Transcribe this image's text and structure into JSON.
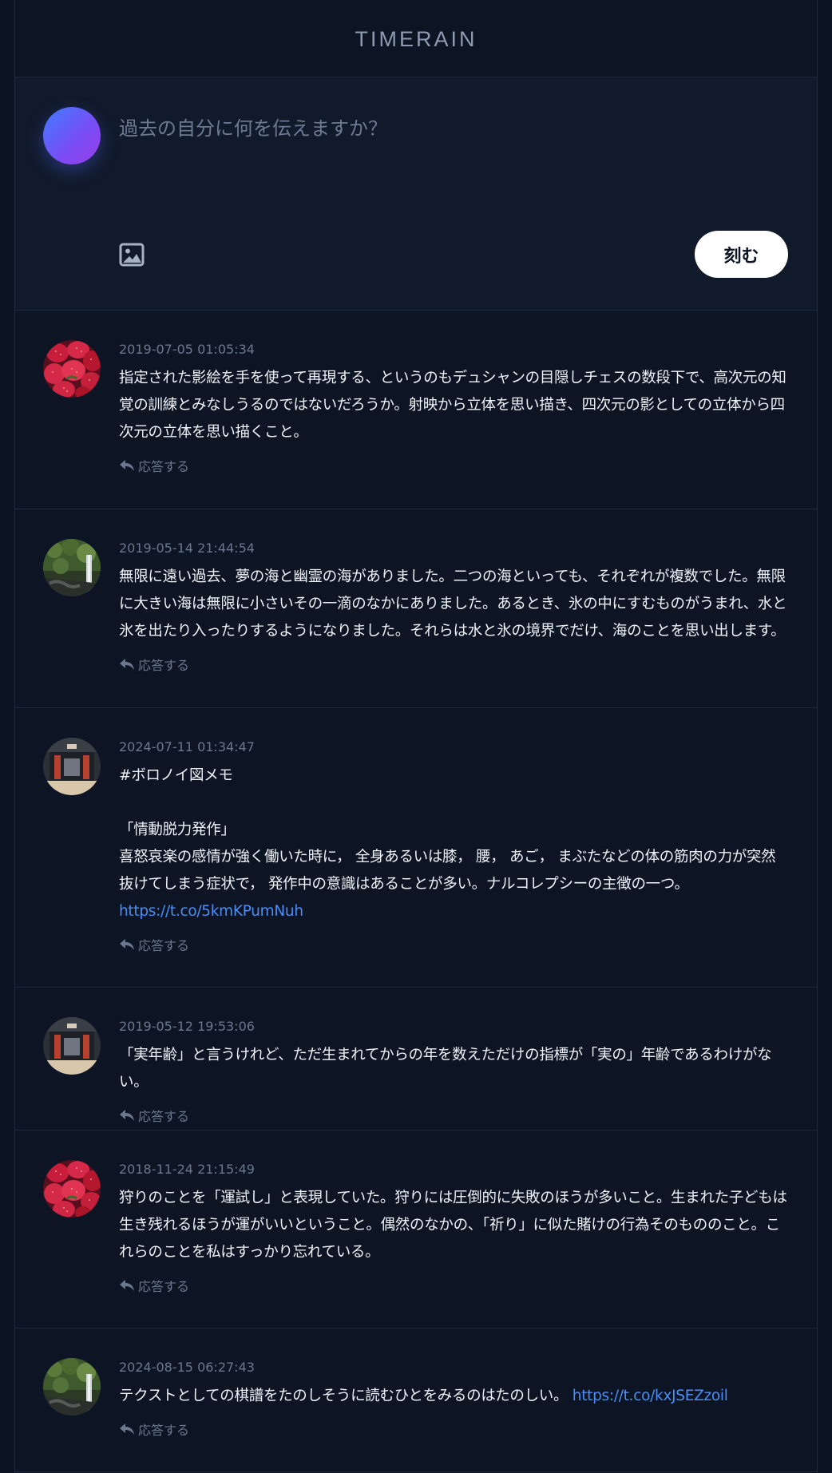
{
  "app": {
    "title": "TIMERAIN"
  },
  "composer": {
    "placeholder": "過去の自分に何を伝えますか？",
    "post_label": "刻む",
    "image_icon": "image-icon"
  },
  "posts": [
    {
      "avatar": "strawberries",
      "timestamp": "2019-07-05 01:05:34",
      "text": "指定された影絵を手を使って再現する、というのもデュシャンの目隠しチェスの数段下で、高次元の知覚の訓練とみなしうるのではないだろうか。射映から立体を思い描き、四次元の影としての立体から四次元の立体を思い描くこと。",
      "reply_label": "応答する"
    },
    {
      "avatar": "waterfall",
      "timestamp": "2019-05-14 21:44:54",
      "text": "無限に遠い過去、夢の海と幽霊の海がありました。二つの海といっても、それぞれが複数でした。無限に大きい海は無限に小さいその一滴のなかにありました。あるとき、氷の中にすむものがうまれ、水と氷を出たり入ったりするようになりました。それらは水と氷の境界でだけ、海のことを思い出します。",
      "reply_label": "応答する"
    },
    {
      "avatar": "storefront",
      "timestamp": "2024-07-11 01:34:47",
      "text": "#ボロノイ図メモ\n\n「情動脱力発作」\n喜怒哀楽の感情が強く働いた時に， 全身あるいは膝， 腰， あご， まぶたなどの体の筋肉の力が突然抜けてしまう症状で， 発作中の意識はあることが多い。ナルコレプシーの主徴の一つ。",
      "link": "https://t.co/5kmKPumNuh",
      "reply_label": "応答する"
    },
    {
      "avatar": "storefront",
      "timestamp": "2019-05-12 19:53:06",
      "text": "「実年齢」と言うけれど、ただ生まれてからの年を数えただけの指標が「実の」年齢であるわけがない。",
      "reply_label": "応答する"
    },
    {
      "avatar": "strawberries",
      "timestamp": "2018-11-24 21:15:49",
      "text": "狩りのことを「運試し」と表現していた。狩りには圧倒的に失敗のほうが多いこと。生まれた子どもは生き残れるほうが運がいいということ。偶然のなかの、「祈り」に似た賭けの行為そのもののこと。これらのことを私はすっかり忘れている。",
      "reply_label": "応答する"
    },
    {
      "avatar": "waterfall",
      "timestamp": "2024-08-15 06:27:43",
      "text": "テクストとしての棋譜をたのしそうに読むひとをみるのはたのしい。",
      "link": "https://t.co/kxJSEZzoil",
      "reply_label": "応答する"
    }
  ]
}
